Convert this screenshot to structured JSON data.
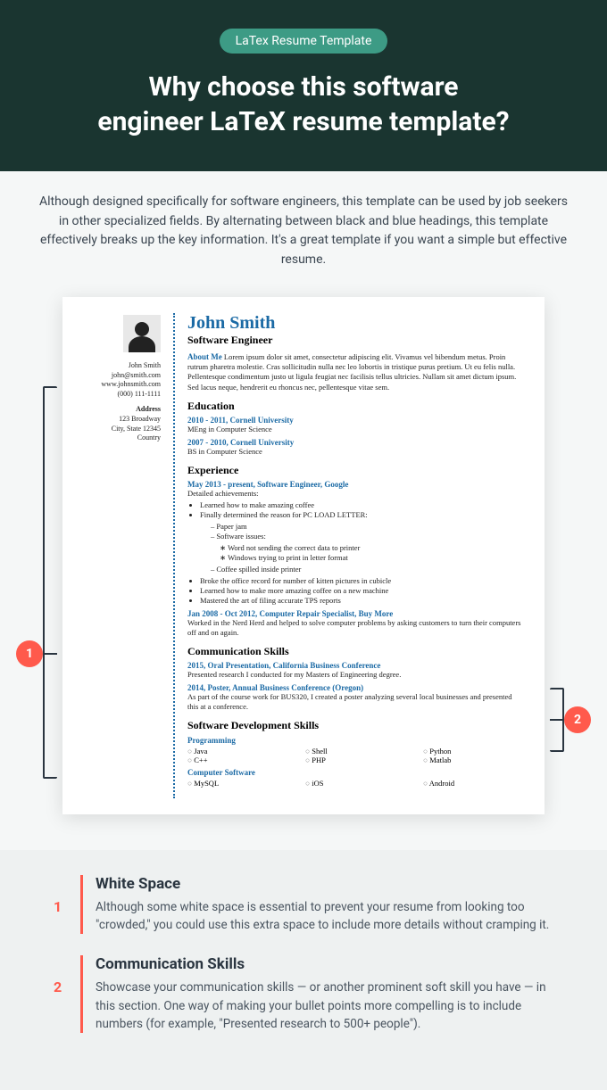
{
  "hero": {
    "pill": "LaTex Resume Template",
    "title_l1": "Why choose this software",
    "title_l2": "engineer LaTeX resume template?"
  },
  "intro": "Although designed specifically for software engineers, this template can be used by job seekers in other specialized fields. By alternating between black and blue headings, this template effectively breaks up the key information. It's a great template if you want a simple but effective resume.",
  "bubbles": {
    "b1": "1",
    "b2": "2"
  },
  "resume": {
    "name": "John Smith",
    "title": "Software Engineer",
    "side": {
      "name": "John Smith",
      "email": "john@smith.com",
      "web": "www.johnsmith.com",
      "phone": "(000) 111-1111",
      "addr_hd": "Address",
      "addr1": "123 Broadway",
      "addr2": "City, State 12345",
      "addr3": "Country"
    },
    "about_hd": "About Me",
    "about": "  Lorem ipsum dolor sit amet, consectetur adipiscing elit. Vivamus vel bibendum metus. Proin rutrum pharetra molestie. Cras sollicitudin nulla nec leo lobortis in tristique purus pretium. Ut eu felis nulla. Pellentesque condimentum justo ut ligula feugiat nec facilisis tellus ultricies. Nullam sit amet dictum ipsum. Sed lacus neque, hendrerit eu rhoncus nec, pellentesque vitae sem.",
    "edu_hd": "Education",
    "edu1_a": "2010 - 2011, Cornell University",
    "edu1_b": "MEng in Computer Science",
    "edu2_a": "2007 - 2010, Cornell University",
    "edu2_b": "BS in Computer Science",
    "exp_hd": "Experience",
    "exp1_a": "May 2013 - present, Software Engineer, Google",
    "exp1_b": "Detailed achievements:",
    "exp1_li1": "Learned how to make amazing coffee",
    "exp1_li2": "Finally determined the reason for PC LOAD LETTER:",
    "exp1_li2a": "Paper jam",
    "exp1_li2b": "Software issues:",
    "exp1_li2b1": "Word not sending the correct data to printer",
    "exp1_li2b2": "Windows trying to print in letter format",
    "exp1_li2c": "Coffee spilled inside printer",
    "exp1_li3": "Broke the office record for number of kitten pictures in cubicle",
    "exp1_li4": "Learned how to make more amazing coffee on a new machine",
    "exp1_li5": "Mastered the art of filing accurate TPS reports",
    "exp2_a": "Jan 2008 - Oct 2012, Computer Repair Specialist, Buy More",
    "exp2_b": "Worked in the Nerd Herd and helped to solve computer problems by asking customers to turn their computers off and on again.",
    "comm_hd": "Communication Skills",
    "comm1_a": "2015, Oral Presentation, California Business Conference",
    "comm1_b": "Presented research I conducted for my Masters of Engineering degree.",
    "comm2_a": "2014, Poster, Annual Business Conference (Oregon)",
    "comm2_b": "As part of the course work for BUS320, I created a poster analyzing several local businesses and presented this at a conference.",
    "dev_hd": "Software Development Skills",
    "sk_prog": "Programming",
    "sk_java": "Java",
    "sk_cpp": "C++",
    "sk_shell": "Shell",
    "sk_php": "PHP",
    "sk_py": "Python",
    "sk_mat": "Matlab",
    "sk_soft": "Computer Software",
    "sk_mysql": "MySQL",
    "sk_ios": "iOS",
    "sk_and": "Android"
  },
  "annotations": [
    {
      "num": "1",
      "title": "White Space",
      "text": "Although some white space is essential to prevent your resume from looking too \"crowded,\" you could use this extra space to include more details without cramping it."
    },
    {
      "num": "2",
      "title": "Communication Skills",
      "text": "Showcase your communication skills — or another prominent soft skill you have — in this section. One way of making your bullet points more compelling is to include numbers (for example, \"Presented research to 500+ people\")."
    }
  ]
}
